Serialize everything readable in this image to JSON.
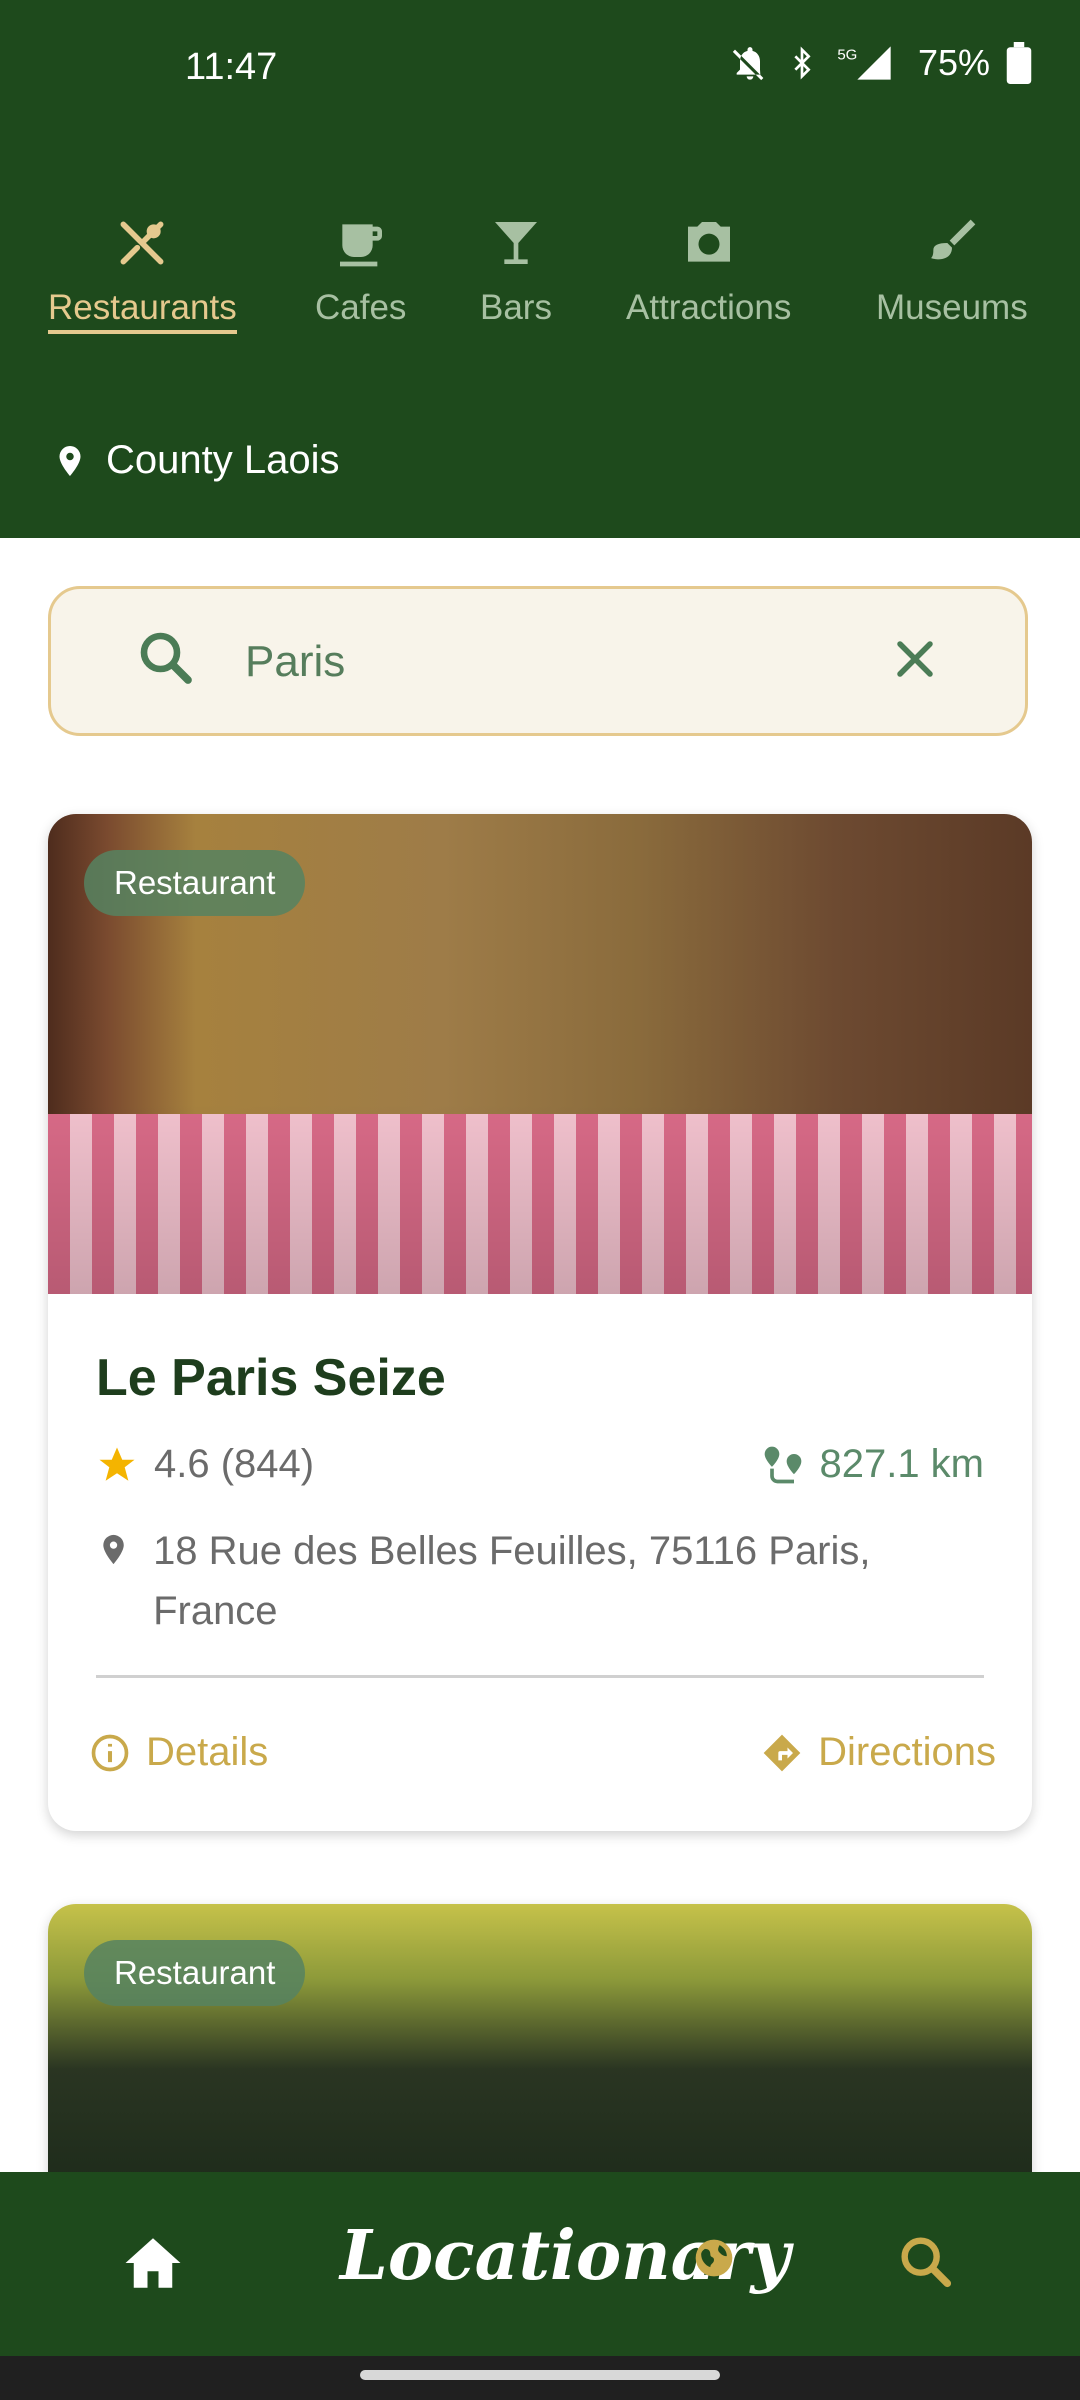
{
  "status_bar": {
    "time": "11:47",
    "battery": "75%"
  },
  "categories": [
    {
      "label": "Restaurants",
      "icon": "restaurant-icon",
      "active": true
    },
    {
      "label": "Cafes",
      "icon": "cafe-icon",
      "active": false
    },
    {
      "label": "Bars",
      "icon": "bar-icon",
      "active": false
    },
    {
      "label": "Attractions",
      "icon": "camera-icon",
      "active": false
    },
    {
      "label": "Museums",
      "icon": "brush-icon",
      "active": false
    }
  ],
  "location": "County Laois",
  "search": {
    "value": "Paris"
  },
  "cards": [
    {
      "badge": "Restaurant",
      "name": "Le Paris Seize",
      "rating": "4.6 (844)",
      "distance": "827.1 km",
      "address": "18 Rue des Belles Feuilles, 75116 Paris, France",
      "details_label": "Details",
      "directions_label": "Directions"
    },
    {
      "badge": "Restaurant"
    }
  ],
  "bottom_nav": {
    "brand": "Locationary"
  },
  "colors": {
    "primary": "#1e4a1c",
    "accent": "#e5c98e",
    "gold": "#c9a94b"
  }
}
